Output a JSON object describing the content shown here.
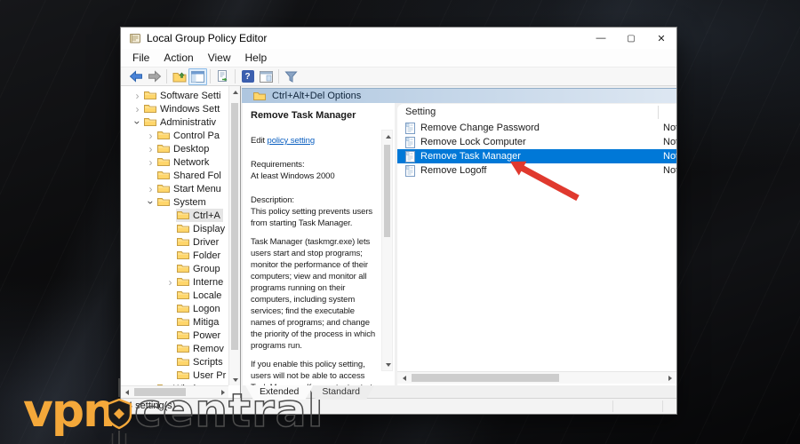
{
  "window": {
    "title": "Local Group Policy Editor",
    "controls": {
      "minimize": "—",
      "maximize": "▢",
      "close": "✕"
    }
  },
  "menu": {
    "items": [
      "File",
      "Action",
      "View",
      "Help"
    ]
  },
  "toolbar": {
    "icons": [
      "back-icon",
      "forward-icon",
      "up-one-level-folder-icon",
      "show-console-tree-icon",
      "export-list-icon",
      "help-icon",
      "show-window-icon",
      "filter-icon"
    ]
  },
  "tree": {
    "items": [
      {
        "label": "Software Setti",
        "level": 0,
        "chevron": "collapsed"
      },
      {
        "label": "Windows Sett",
        "level": 0,
        "chevron": "collapsed"
      },
      {
        "label": "Administrativ",
        "level": 0,
        "chevron": "expanded"
      },
      {
        "label": "Control Pa",
        "level": 1,
        "chevron": "collapsed"
      },
      {
        "label": "Desktop",
        "level": 1,
        "chevron": "collapsed"
      },
      {
        "label": "Network",
        "level": 1,
        "chevron": "collapsed"
      },
      {
        "label": "Shared Fol",
        "level": 1,
        "chevron": "none"
      },
      {
        "label": "Start Menu",
        "level": 1,
        "chevron": "collapsed"
      },
      {
        "label": "System",
        "level": 1,
        "chevron": "expanded"
      },
      {
        "label": "Ctrl+A",
        "level": 2,
        "chevron": "none",
        "selected": true
      },
      {
        "label": "Display",
        "level": 2,
        "chevron": "none"
      },
      {
        "label": "Driver",
        "level": 2,
        "chevron": "none"
      },
      {
        "label": "Folder",
        "level": 2,
        "chevron": "none"
      },
      {
        "label": "Group",
        "level": 2,
        "chevron": "none"
      },
      {
        "label": "Interne",
        "level": 2,
        "chevron": "collapsed"
      },
      {
        "label": "Locale",
        "level": 2,
        "chevron": "none"
      },
      {
        "label": "Logon",
        "level": 2,
        "chevron": "none"
      },
      {
        "label": "Mitiga",
        "level": 2,
        "chevron": "none"
      },
      {
        "label": "Power",
        "level": 2,
        "chevron": "none"
      },
      {
        "label": "Remov",
        "level": 2,
        "chevron": "none"
      },
      {
        "label": "Scripts",
        "level": 2,
        "chevron": "none"
      },
      {
        "label": "User Pr",
        "level": 2,
        "chevron": "none"
      },
      {
        "label": "Windows",
        "level": 1,
        "chevron": "none",
        "partial": true
      }
    ]
  },
  "details": {
    "header": "Ctrl+Alt+Del Options",
    "policy_title": "Remove Task Manager",
    "edit_prefix": "Edit ",
    "edit_link": "policy setting",
    "requirements_label": "Requirements:",
    "requirements": "At least Windows 2000",
    "description_label": "Description:",
    "paragraphs": [
      "This policy setting prevents users from starting Task Manager.",
      "Task Manager (taskmgr.exe) lets users start and stop programs; monitor the performance of their computers; view and monitor all programs running on their computers, including system services; find the executable names of programs; and change the priority of the process in which programs run.",
      "If you enable this policy setting, users will not be able to access Task Manager. If users try to start"
    ]
  },
  "list": {
    "header": "Setting",
    "rows": [
      {
        "name": "Remove Change Password",
        "state": "Not",
        "selected": false
      },
      {
        "name": "Remove Lock Computer",
        "state": "Not",
        "selected": false
      },
      {
        "name": "Remove Task Manager",
        "state": "Not",
        "selected": true
      },
      {
        "name": "Remove Logoff",
        "state": "Not",
        "selected": false
      }
    ]
  },
  "tabs": [
    "Extended",
    "Standard"
  ],
  "status_bar": {
    "text": "4 setting(s)"
  },
  "logo": {
    "part1": "vpn",
    "part2": "central"
  },
  "colors": {
    "selection_blue": "#0078d7",
    "header_gradient_start": "#aec6df",
    "header_gradient_end": "#dde7f2",
    "link_blue": "#0b5fc0",
    "folder_yellow": "#ffd66b",
    "arrow_red": "#e0392e",
    "logo_yellow": "#f4a83a"
  }
}
